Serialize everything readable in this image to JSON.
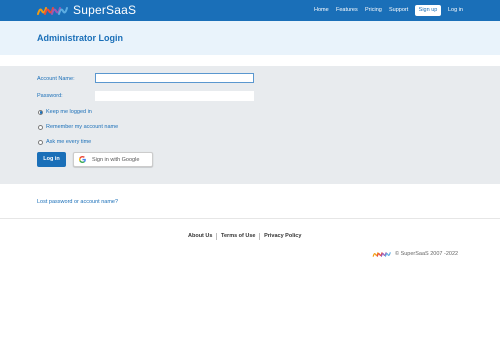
{
  "header": {
    "logo_text": "SuperSaaS",
    "nav": {
      "home": "Home",
      "features": "Features",
      "pricing": "Pricing",
      "support": "Support",
      "signup": "Sign up",
      "login": "Log in"
    }
  },
  "page_title": "Administrator Login",
  "form": {
    "account_label": "Account Name:",
    "account_value": "",
    "password_label": "Password:",
    "password_value": "",
    "options": [
      {
        "label": "Keep me logged in",
        "checked": true
      },
      {
        "label": "Remember my account name",
        "checked": false
      },
      {
        "label": "Ask me every time",
        "checked": false
      }
    ],
    "login_button": "Log in",
    "google_button": "Sign in with Google"
  },
  "lost_link": "Lost password or account name?",
  "footer": {
    "links": [
      "About Us",
      "Terms of Use",
      "Privacy Policy"
    ],
    "copyright": "© SuperSaaS 2007 -2022"
  },
  "colors": {
    "brand_blue": "#1a6fb8",
    "title_band": "#e9f3fb",
    "form_band": "#e8ebee"
  },
  "icons": {
    "logo": "supersaas-logo-icon",
    "google": "google-g-icon",
    "radio": "radio-icon"
  }
}
